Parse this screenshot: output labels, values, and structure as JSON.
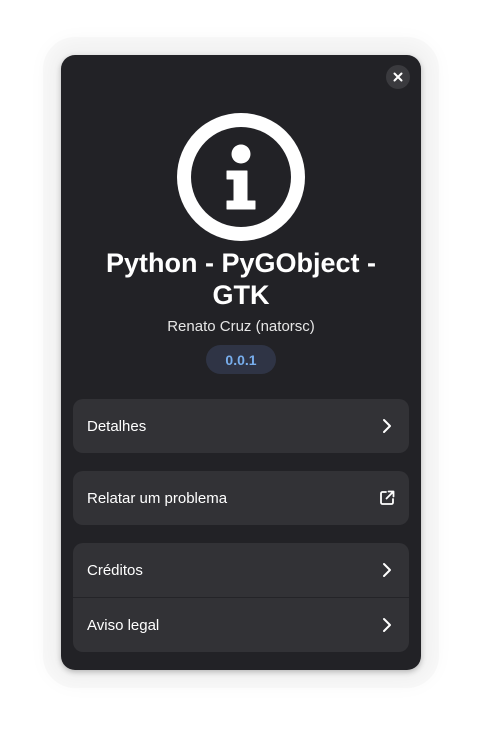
{
  "dialog": {
    "app_name": "Python - PyGObject - GTK",
    "developer": "Renato Cruz (natorsc)",
    "version": "0.0.1",
    "app_icon": "info-icon",
    "close_icon": "close-icon"
  },
  "rows": {
    "details": {
      "label": "Detalhes",
      "icon": "chevron-right-icon"
    },
    "report": {
      "label": "Relatar um problema",
      "icon": "external-link-icon"
    },
    "credits": {
      "label": "Créditos",
      "icon": "chevron-right-icon"
    },
    "legal": {
      "label": "Aviso legal",
      "icon": "chevron-right-icon"
    }
  },
  "colors": {
    "window_bg": "#222226",
    "card_bg": "#323236",
    "version_bg": "#2f3445",
    "version_text": "#78aeed"
  }
}
